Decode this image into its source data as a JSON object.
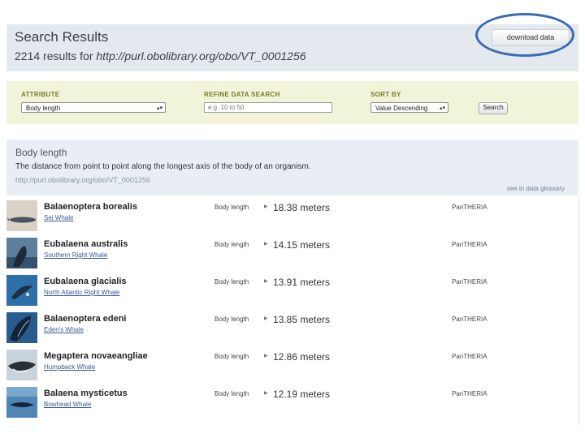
{
  "header": {
    "title": "Search Results",
    "results_count": "2214 results for",
    "query_uri": "http://purl.obolibrary.org/obo/VT_0001256",
    "download_label": "download data"
  },
  "filters": {
    "attribute_label": "ATTRIBUTE",
    "attribute_value": "Body length",
    "refine_label": "REFINE DATA SEARCH",
    "refine_placeholder": "e.g. 10 to 50",
    "sort_label": "SORT BY",
    "sort_value": "Value Descending",
    "search_label": "Search"
  },
  "definition": {
    "title": "Body length",
    "text": "The distance from point to point along the longest axis of the body of an organism.",
    "uri": "http://purl.obolibrary.org/obo/VT_0001256",
    "glossary_link": "see in data glossary"
  },
  "results": [
    {
      "scientific": "Balaenoptera borealis",
      "common": "Sei Whale",
      "attribute": "Body length",
      "value": "18.38 meters",
      "source": "PanTHERIA"
    },
    {
      "scientific": "Eubalaena australis",
      "common": "Southern Right Whale",
      "attribute": "Body length",
      "value": "14.15 meters",
      "source": "PanTHERIA"
    },
    {
      "scientific": "Eubalaena glacialis",
      "common": "North Atlantic Right Whale",
      "attribute": "Body length",
      "value": "13.91 meters",
      "source": "PanTHERIA"
    },
    {
      "scientific": "Balaenoptera edeni",
      "common": "Eden's Whale",
      "attribute": "Body length",
      "value": "13.85 meters",
      "source": "PanTHERIA"
    },
    {
      "scientific": "Megaptera novaeangliae",
      "common": "Humpback Whale",
      "attribute": "Body length",
      "value": "12.86 meters",
      "source": "PanTHERIA"
    },
    {
      "scientific": "Balaena mysticetus",
      "common": "Bowhead Whale",
      "attribute": "Body length",
      "value": "12.19 meters",
      "source": "PanTHERIA"
    }
  ],
  "colors": {
    "header_bg": "#e3e9ef",
    "filter_bg": "#f1f4d9",
    "definition_bg": "#e8eef4",
    "link": "#3a5a93",
    "highlight_oval": "#3a6bb3"
  }
}
